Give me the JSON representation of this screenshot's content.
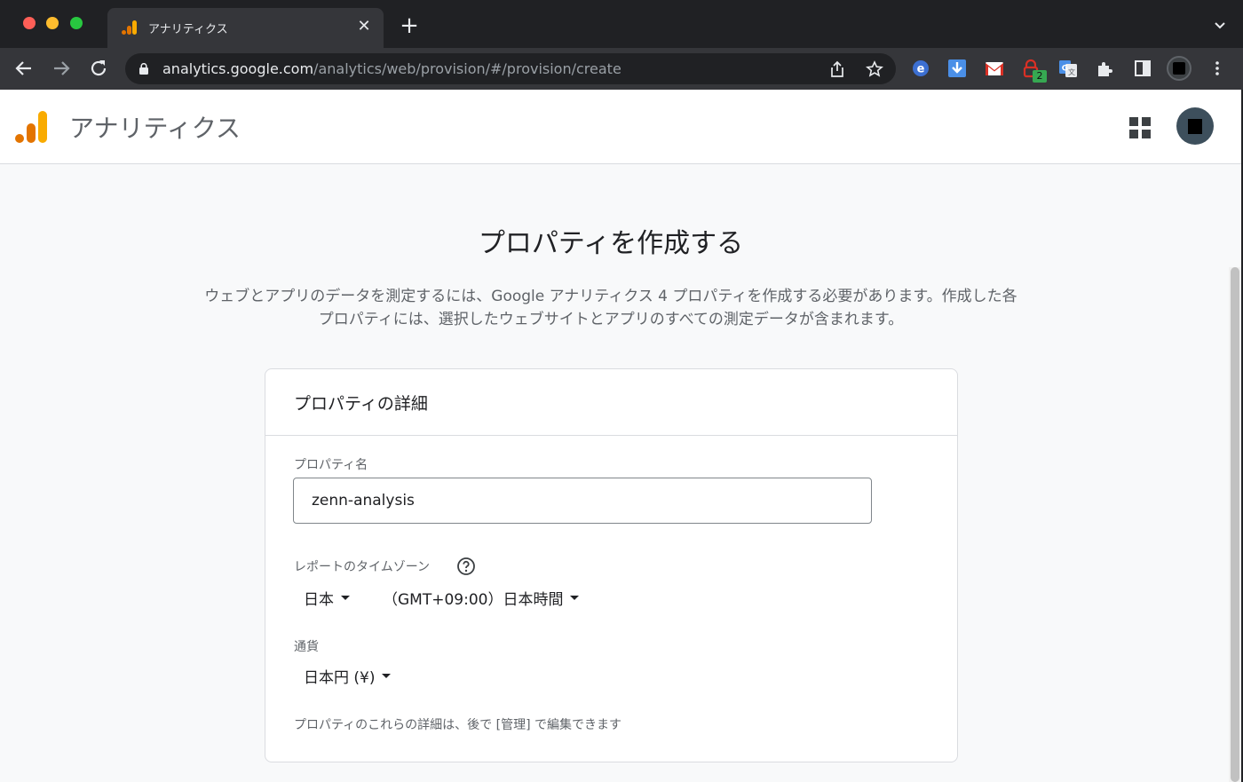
{
  "browser": {
    "tab": {
      "title": "アナリティクス"
    },
    "address_bar": {
      "host": "analytics.google.com",
      "path": "/analytics/web/provision/#/provision/create"
    },
    "extensions": [
      {
        "icon": "e-extension-icon"
      },
      {
        "icon": "download-arrow-icon"
      },
      {
        "icon": "gmail-icon"
      },
      {
        "icon": "lock-extension-icon",
        "badge": "2"
      },
      {
        "icon": "translate-icon"
      },
      {
        "icon": "puzzle-icon"
      },
      {
        "icon": "side-panel-icon"
      }
    ]
  },
  "app": {
    "title": "アナリティクス",
    "brand_colors": {
      "orange": "#f9ab00",
      "dark_orange": "#e37400"
    }
  },
  "main": {
    "heading": "プロパティを作成する",
    "intro_line1": "ウェブとアプリのデータを測定するには、Google アナリティクス 4 プロパティを作成する必要があります。作成した各",
    "intro_line2": "プロパティには、選択したウェブサイトとアプリのすべての測定データが含まれます。",
    "card": {
      "title": "プロパティの詳細",
      "property_name": {
        "label": "プロパティ名",
        "value": "zenn-analysis"
      },
      "timezone": {
        "label": "レポートのタイムゾーン",
        "country": "日本",
        "zone": "（GMT+09:00）日本時間"
      },
      "currency": {
        "label": "通貨",
        "value": "日本円 (¥)"
      },
      "hint": "プロパティのこれらの詳細は、後で [管理] で編集できます"
    }
  }
}
